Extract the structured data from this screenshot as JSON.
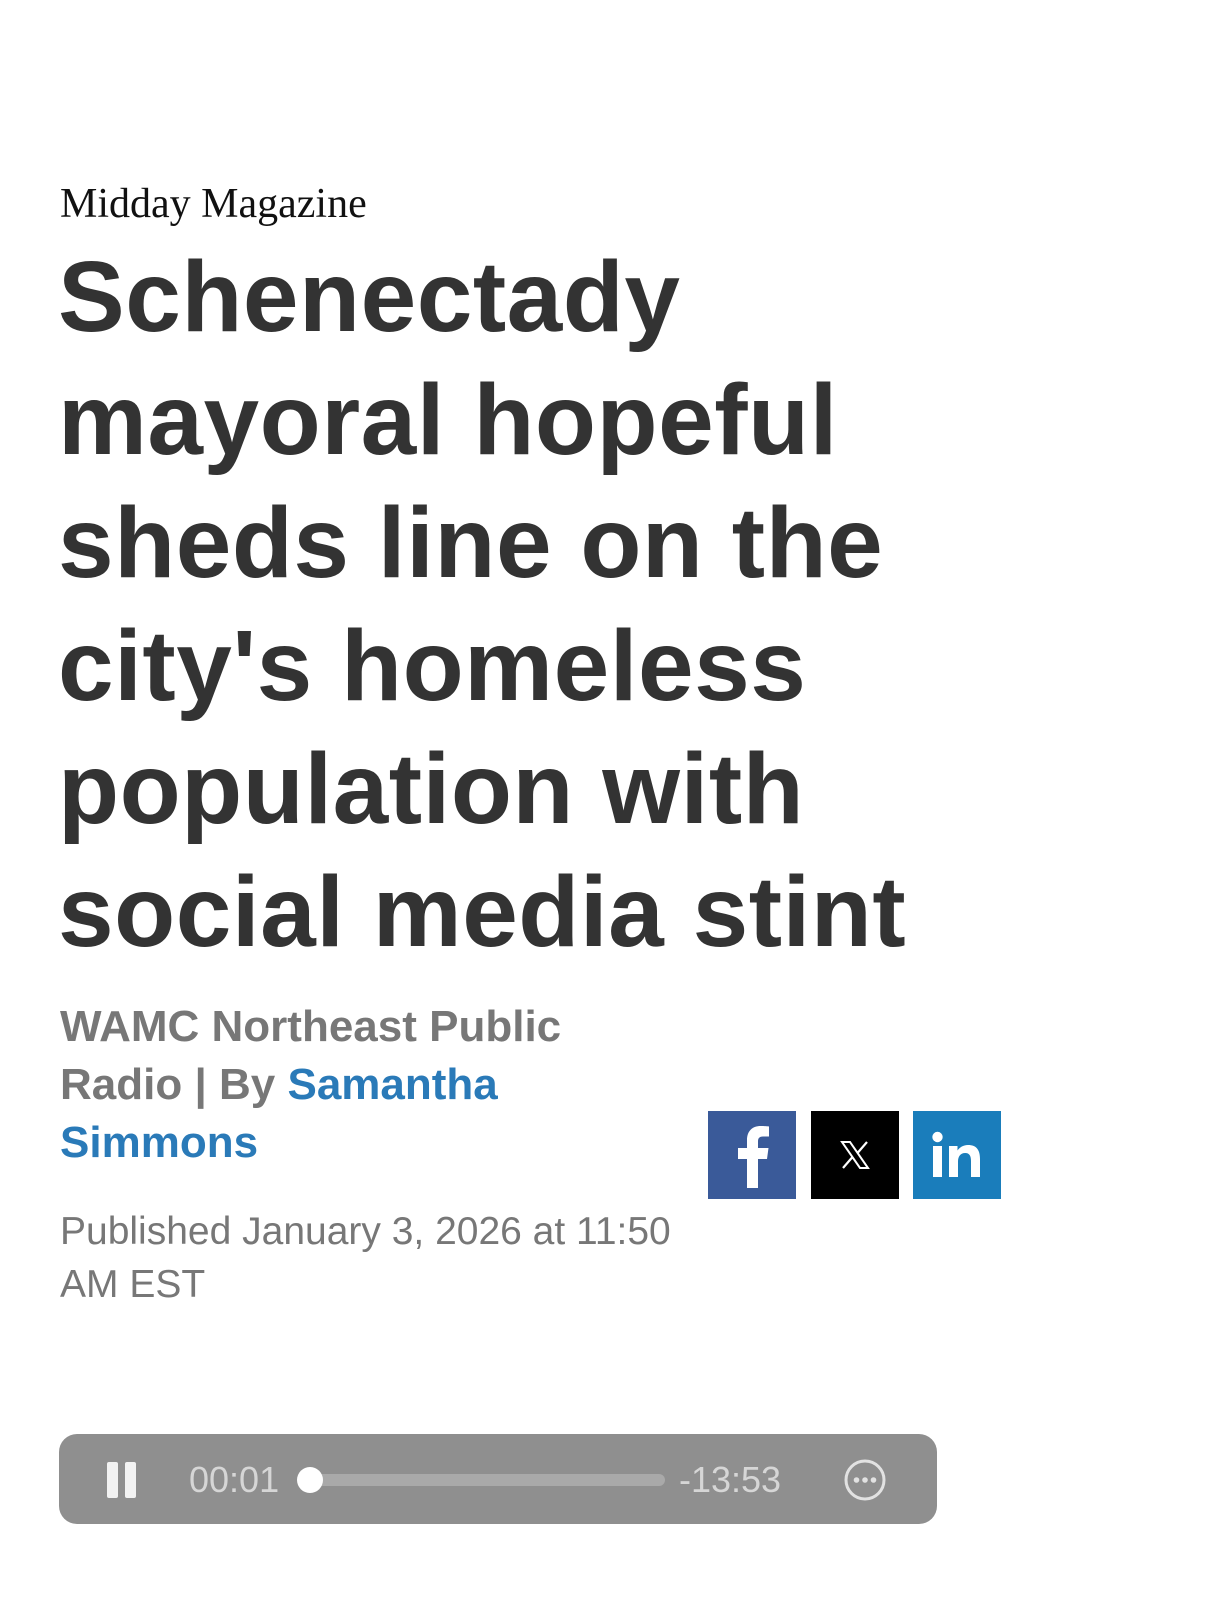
{
  "article": {
    "section": "Midday Magazine",
    "headline_lines": [
      "Schenectady",
      "mayoral hopeful",
      "sheds line on the",
      "city's homeless",
      "population with",
      "social media stint"
    ],
    "byline": {
      "source_line1": "WAMC Northeast Public",
      "source_line2_prefix": "Radio | By ",
      "author_part1": "Samantha",
      "author_part2": "Simmons"
    },
    "published_lines": [
      "Published January 3, 2026 at 11:50",
      "AM EST"
    ]
  },
  "share": [
    {
      "name": "facebook",
      "icon": "facebook-icon",
      "glyph": "f",
      "color": "#3a5a99"
    },
    {
      "name": "x",
      "icon": "x-icon",
      "glyph": "𝕏",
      "color": "#000000"
    },
    {
      "name": "linkedin",
      "icon": "linkedin-icon",
      "glyph": "in",
      "color": "#1a7dbb"
    }
  ],
  "player": {
    "state": "playing",
    "elapsed": "00:01",
    "remaining": "-13:53",
    "progress_fraction": 0.02,
    "icons": {
      "toggle": "pause-icon",
      "more": "more-options-icon"
    }
  },
  "colors": {
    "headline": "#333333",
    "meta": "#777777",
    "link": "#2a7ab8",
    "player_bg": "#8f8f8f"
  }
}
